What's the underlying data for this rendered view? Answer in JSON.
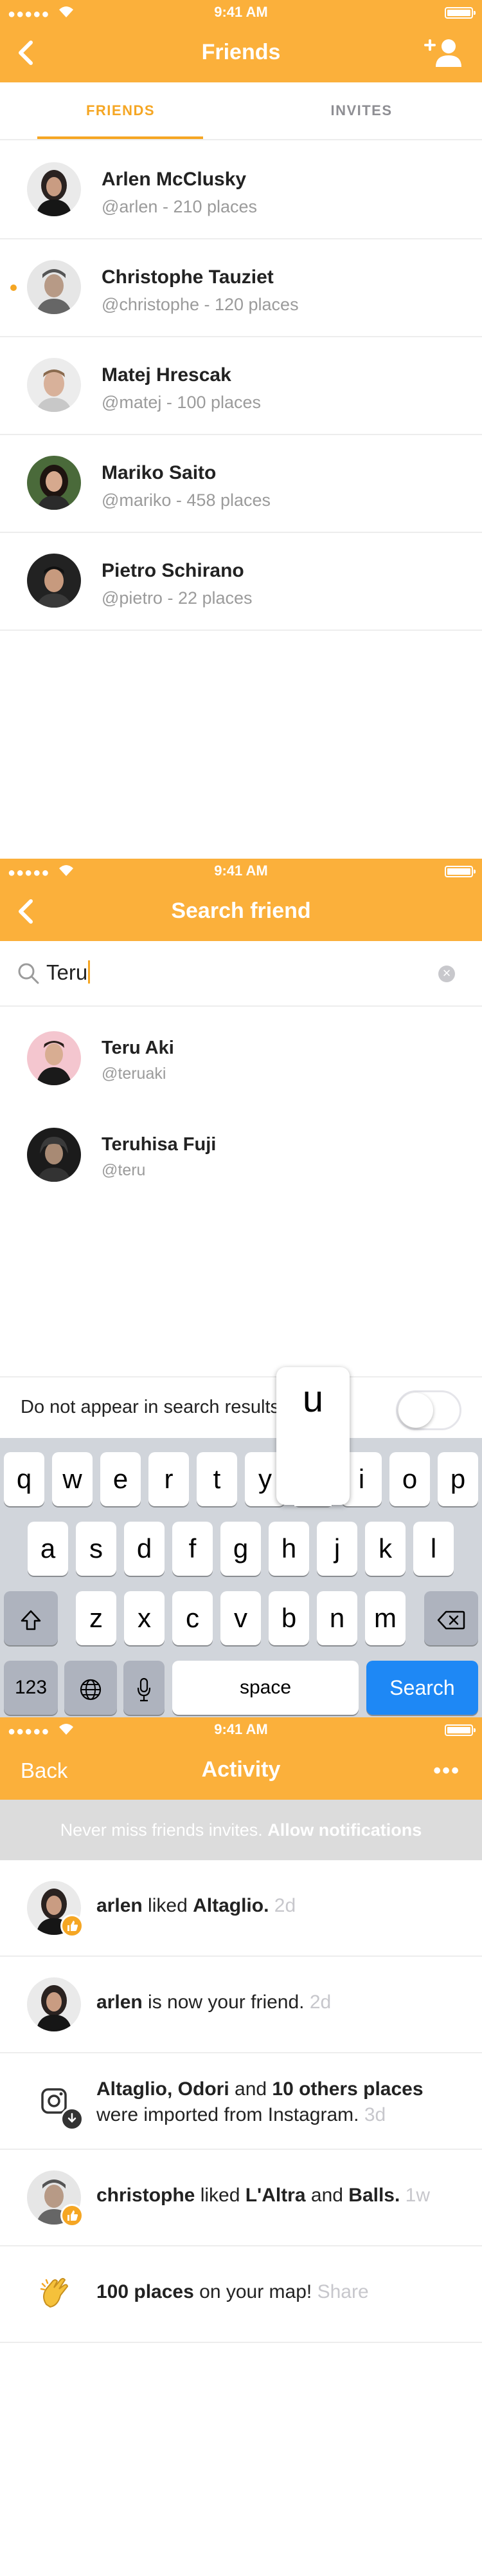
{
  "status_bar": {
    "time": "9:41 AM",
    "signal": "●●●●●"
  },
  "friends_screen": {
    "title": "Friends",
    "tabs": [
      {
        "label": "FRIENDS"
      },
      {
        "label": "INVITES"
      }
    ],
    "friends": [
      {
        "name": "Arlen McClusky",
        "sub": "@arlen - 210 places"
      },
      {
        "name": "Christophe Tauziet",
        "sub": "@christophe - 120 places"
      },
      {
        "name": "Matej Hrescak",
        "sub": "@matej - 100 places"
      },
      {
        "name": "Mariko Saito",
        "sub": "@mariko - 458 places"
      },
      {
        "name": "Pietro Schirano",
        "sub": "@pietro - 22 places"
      }
    ]
  },
  "search_screen": {
    "title": "Search friend",
    "search_value": "Teru",
    "results": [
      {
        "name": "Teru Aki",
        "sub": "@teruaki"
      },
      {
        "name": "Teruhisa Fuji",
        "sub": "@teru"
      }
    ],
    "privacy_label": "Do not appear in search results",
    "keyboard": {
      "row1": [
        "q",
        "w",
        "e",
        "r",
        "t",
        "y",
        "u",
        "i",
        "o",
        "p"
      ],
      "row2": [
        "a",
        "s",
        "d",
        "f",
        "g",
        "h",
        "j",
        "k",
        "l"
      ],
      "row3": [
        "z",
        "x",
        "c",
        "v",
        "b",
        "n",
        "m"
      ],
      "numbers_label": "123",
      "space_label": "space",
      "search_label": "Search",
      "popup_key": "u"
    }
  },
  "activity_screen": {
    "back_label": "Back",
    "title": "Activity",
    "more_label": "•••",
    "banner": {
      "text": "Never miss friends invites.",
      "link": "Allow notifications"
    },
    "items": [
      {
        "b1": "arlen",
        "t1": " liked ",
        "b2": "Altaglio.",
        "time": "2d"
      },
      {
        "b1": "arlen",
        "t1": " is now your friend.",
        "time": "2d"
      },
      {
        "b1": "Altaglio, Odori",
        "t1": " and ",
        "b2": "10 others places",
        "line2": "were imported from Instagram.",
        "time": "3d"
      },
      {
        "b1": "christophe",
        "t1": " liked ",
        "b2": "L'Altra",
        "t2": " and ",
        "b3": "Balls.",
        "time": "1w"
      },
      {
        "b1": "100 places",
        "t1": " on your map!",
        "action": "Share"
      }
    ]
  },
  "colors": {
    "accent": "#FBB03B",
    "tab_active": "#F5A623",
    "key_blue": "#1E88F5"
  }
}
